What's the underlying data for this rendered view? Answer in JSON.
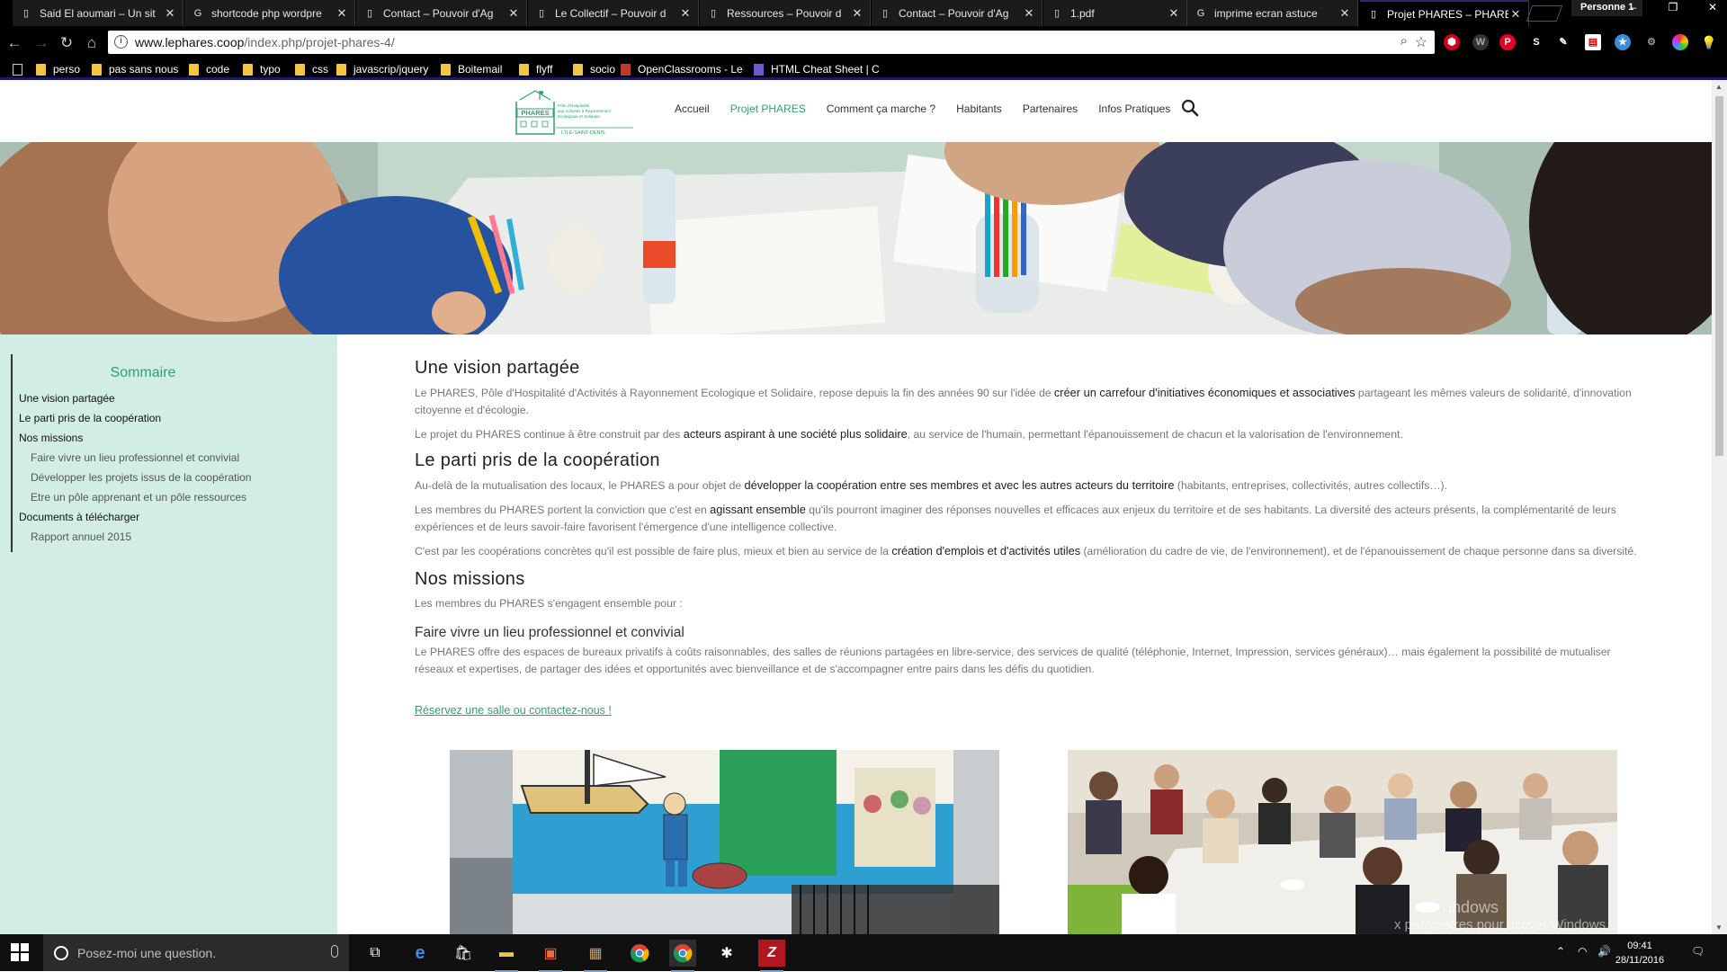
{
  "browser": {
    "tabs": [
      {
        "title": "Said El aoumari – Un sit",
        "active": false
      },
      {
        "title": "shortcode php wordpre",
        "active": false
      },
      {
        "title": "Contact – Pouvoir d'Ag",
        "active": false
      },
      {
        "title": "Le Collectif – Pouvoir d",
        "active": false
      },
      {
        "title": "Ressources – Pouvoir d",
        "active": false
      },
      {
        "title": "Contact – Pouvoir d'Ag",
        "active": false
      },
      {
        "title": "1.pdf",
        "active": false
      },
      {
        "title": "imprime ecran astuce",
        "active": false
      },
      {
        "title": "Projet PHARES – PHARE",
        "active": true
      }
    ],
    "profile": "Personne 1",
    "url_host": "www.lephares.coop",
    "url_path": "/index.php/projet-phares-4/",
    "bookmarks": [
      {
        "label": "",
        "type": "page"
      },
      {
        "label": "perso",
        "type": "folder"
      },
      {
        "label": "pas sans nous",
        "type": "folder"
      },
      {
        "label": "code",
        "type": "folder"
      },
      {
        "label": "typo",
        "type": "folder"
      },
      {
        "label": "css",
        "type": "folder"
      },
      {
        "label": "javascrip/jquery",
        "type": "folder"
      },
      {
        "label": "Boitemail",
        "type": "folder"
      },
      {
        "label": "flyff",
        "type": "folder"
      },
      {
        "label": "socio",
        "type": "folder"
      },
      {
        "label": "OpenClassrooms - Le",
        "type": "site"
      },
      {
        "label": "HTML Cheat Sheet | C",
        "type": "site"
      }
    ]
  },
  "site": {
    "logo": {
      "name": "PHARES",
      "tagline": "Pôle d'Hospitalité aux Activités à Rayonnement Écologique et Solidaire",
      "city": "L'ÎLE-SAINT-DENIS"
    },
    "nav": [
      "Accueil",
      "Projet PHARES",
      "Comment ça marche ?",
      "Habitants",
      "Partenaires",
      "Infos Pratiques"
    ],
    "nav_active": "Projet PHARES",
    "accent": "#2fa36b",
    "sidebar_bg": "#d2ede3"
  },
  "sidebar": {
    "title": "Sommaire",
    "items": [
      {
        "label": "Une vision partagée",
        "level": 1
      },
      {
        "label": "Le parti pris de la coopération",
        "level": 1
      },
      {
        "label": "Nos missions",
        "level": 1
      },
      {
        "label": "Faire vivre un lieu professionnel et convivial",
        "level": 2
      },
      {
        "label": "Développer les projets issus de la coopération",
        "level": 2
      },
      {
        "label": "Etre un pôle apprenant et un pôle ressources",
        "level": 2
      },
      {
        "label": "Documents à télécharger",
        "level": 1
      },
      {
        "label": "Rapport annuel 2015",
        "level": 2
      }
    ]
  },
  "content": {
    "s1_title": "Une vision partagée",
    "s1_p1_a": "Le PHARES, Pôle d'Hospitalité d'Activités à Rayonnement Ecologique et Solidaire, repose depuis la fin des années 90 sur l'idée de ",
    "s1_p1_b": "créer un carrefour d'initiatives économiques et associatives",
    "s1_p1_c": " partageant les mêmes valeurs de solidarité, d'innovation citoyenne et d'écologie.",
    "s1_p2_a": "Le projet du PHARES continue à être construit par des ",
    "s1_p2_b": "acteurs aspirant à une société plus solidaire",
    "s1_p2_c": ", au service de l'humain, permettant l'épanouissement de chacun et la valorisation de l'environnement.",
    "s2_title": "Le parti pris de la coopération",
    "s2_p1_a": "Au-delà de la mutualisation des locaux, le PHARES a pour objet de ",
    "s2_p1_b": "développer la coopération entre ses membres et avec les autres acteurs du territoire",
    "s2_p1_c": " (habitants, entreprises, collectivités, autres collectifs…).",
    "s2_p2_a": "Les membres du PHARES portent la conviction que c'est en ",
    "s2_p2_b": "agissant ensemble",
    "s2_p2_c": " qu'ils pourront imaginer des réponses nouvelles et efficaces aux enjeux du territoire et de ses habitants. La diversité des acteurs présents, la complémentarité de leurs expériences et de leurs savoir-faire favorisent l'émergence d'une intelligence collective.",
    "s2_p3_a": "C'est par les coopérations concrètes qu'il est possible de faire plus, mieux et bien au service de la ",
    "s2_p3_b": "création d'emplois et d'activités utiles",
    "s2_p3_c": " (amélioration du cadre de vie, de l'environnement), et de l'épanouissement de chaque personne dans sa diversité.",
    "s3_title": "Nos missions",
    "s3_intro": "Les membres du PHARES s'engagent ensemble pour :",
    "s3_sub1": "Faire vivre un lieu professionnel et convivial",
    "s3_sub1_p": "Le PHARES offre des espaces de bureaux privatifs à coûts raisonnables, des salles de réunions partagées en libre-service, des services de qualité (téléphonie, Internet, Impression, services généraux)… mais également la possibilité de mutualiser réseaux et expertises, de partager des idées et opportunités avec bienveillance et de s'accompagner entre pairs dans les défis du quotidien.",
    "cta": "Réservez une salle ou contactez-nous !"
  },
  "watermark": {
    "line1": "indows",
    "line2": "x paramètres pour activer Windows."
  },
  "taskbar": {
    "search_placeholder": "Posez-moi une question.",
    "time": "09:41",
    "date": "28/11/2016"
  }
}
